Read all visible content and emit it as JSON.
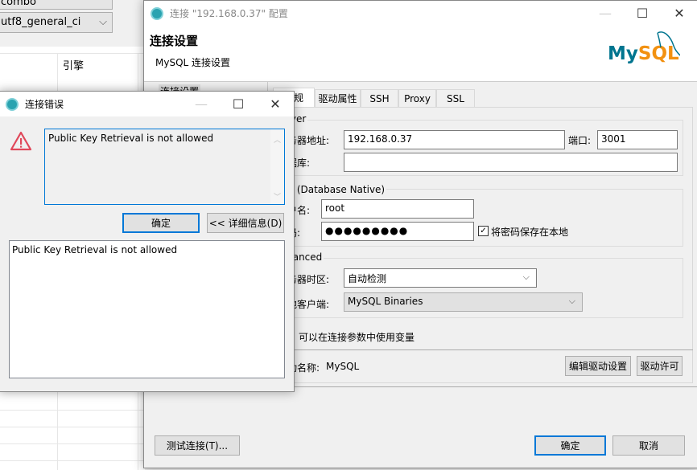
{
  "background_app": {
    "combo_top": "combo",
    "collation_value": "utf8_general_ci",
    "column_engine": "引擎"
  },
  "config_dialog": {
    "title": "连接 \"192.168.0.37\" 配置",
    "heading": "连接设置",
    "subheading": "MySQL 连接设置",
    "logo_text_my": "My",
    "logo_text_sql": "SQL",
    "nav": [
      {
        "label": "连接设置"
      }
    ],
    "tabs": [
      {
        "label": "常规"
      },
      {
        "label": "驱动属性"
      },
      {
        "label": "SSH"
      },
      {
        "label": "Proxy"
      },
      {
        "label": "SSL"
      }
    ],
    "server_group": "Server",
    "host_label": "服务器地址:",
    "host_value": "192.168.0.37",
    "port_label": "端口:",
    "port_value": "3001",
    "database_label": "数据库:",
    "database_value": "",
    "auth_group": "认证 (Database Native)",
    "user_label": "用户名:",
    "user_value": "root",
    "password_label": "密码:",
    "password_value": "●●●●●●●●●",
    "save_password_label": "将密码保存在本地",
    "save_password_checked": true,
    "advanced_group": "Advanced",
    "timezone_label": "服务器时区:",
    "timezone_value": "自动检测",
    "client_label": "本地客户端:",
    "client_value": "MySQL Binaries",
    "variables_note": "可以在连接参数中使用变量",
    "driver_label": "驱动名称:",
    "driver_value": "MySQL",
    "edit_driver_button": "编辑驱动设置",
    "driver_license_button": "驱动许可",
    "test_button": "测试连接(T)...",
    "ok_button": "确定",
    "cancel_button": "取消"
  },
  "error_dialog": {
    "title": "连接错误",
    "message": "Public Key Retrieval is not allowed",
    "ok_button": "确定",
    "details_button": "<< 详细信息(D)",
    "details_text": "Public Key Retrieval is not allowed",
    "warning_color": "#e81123"
  },
  "window_controls": {
    "minimize": "—",
    "maximize": "☐",
    "close": "✕"
  }
}
